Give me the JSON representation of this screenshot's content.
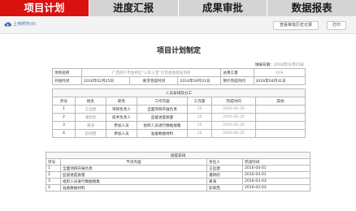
{
  "tabs": [
    "项目计划",
    "进度汇报",
    "成果审批",
    "数据报表"
  ],
  "toolbar": {
    "upload_label": "上传附件(0)",
    "history_btn": "查看审批历史记录",
    "print_btn": "打印"
  },
  "doc": {
    "title": "项目计划制定",
    "date_label": "填报日期：",
    "date_value": "2016年02月25日",
    "info": {
      "name_label": "项目名称",
      "name_value": "广西南宁市金桥区“三农三宝”示范基地建设项目",
      "total_label": "总用工量",
      "total_value": "30天",
      "start_label": "开始时间",
      "start_value": "2016年02月25日",
      "deadline_label": "要求完成时间",
      "deadline_value": "2016年04月31日",
      "expected_label": "预计完成时间",
      "expected_value": "2016年04月31日"
    },
    "staff_section": "人员安排及分工",
    "staff_headers": [
      "序号",
      "姓名",
      "职责",
      "工作内容",
      "工作量",
      "完成时间",
      "其他"
    ],
    "staff_rows": [
      [
        "1",
        "王远建",
        "项目负责人",
        "全面项目开展负责",
        "10",
        "2016-02-25",
        ""
      ],
      [
        "2",
        "潘新欣",
        "技术负责人",
        "监督进度质量",
        "10",
        "2016-02-25",
        ""
      ],
      [
        "3",
        "黄海",
        "参加人员",
        "组织人员进行数据搜集",
        "10",
        "2016-02-25",
        ""
      ],
      [
        "4",
        "彭硕西",
        "参加人员",
        "准备数据材料",
        "10",
        "2016-02-25",
        ""
      ]
    ],
    "schedule_section": "进度安排",
    "schedule_headers": [
      "序号",
      "节点内容",
      "责任人",
      "完成时间"
    ],
    "schedule_rows": [
      [
        "1",
        "全面项目开展负责",
        "王远建",
        "2016-04-01"
      ],
      [
        "2",
        "监督进度质量",
        "潘新欣",
        "2016-04-01"
      ],
      [
        "3",
        "组织人员进行数据搜集",
        "黄海",
        "2016-03-03"
      ],
      [
        "4",
        "准备数据材料",
        "彭硕西",
        "2016-03-03"
      ]
    ]
  },
  "colors": {
    "active_tab": "#d9110f",
    "inactive_tab": "#d4d4d4",
    "link": "#3d6fb3"
  }
}
